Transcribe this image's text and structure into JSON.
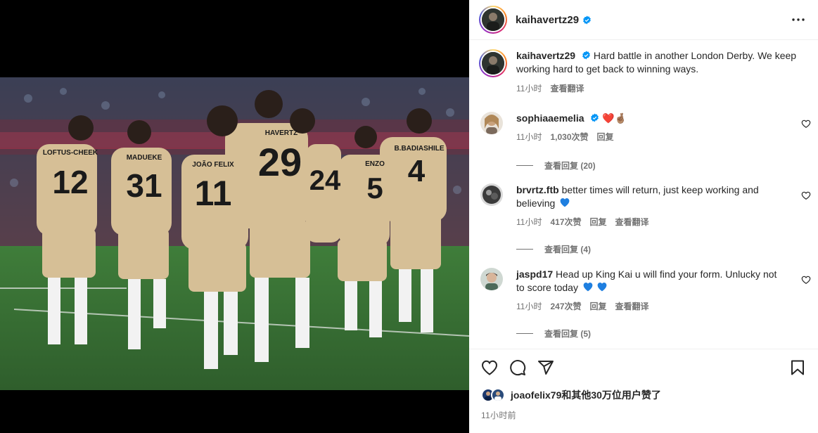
{
  "post": {
    "username": "kaihavertz29",
    "more_label": "•••"
  },
  "caption": {
    "username": "kaihavertz29",
    "text": "Hard battle in another London Derby. We keep working hard to get back to winning ways.",
    "time": "11小时",
    "translate": "查看翻译"
  },
  "comments": [
    {
      "username": "sophiaaemelia",
      "verified": true,
      "text": "❤️🤞🏽",
      "time": "11小时",
      "likes": "1,030次赞",
      "reply": "回复",
      "translate": "",
      "view_replies": "查看回复 (20)"
    },
    {
      "username": "brvrtz.ftb",
      "verified": false,
      "text": "better times will return, just keep working and believing",
      "time": "11小时",
      "likes": "417次赞",
      "reply": "回复",
      "translate": "查看翻译",
      "view_replies": "查看回复 (4)"
    },
    {
      "username": "jaspd17",
      "verified": false,
      "text": "Head up King Kai u will find your form. Unlucky not to score today",
      "time": "11小时",
      "likes": "247次赞",
      "reply": "回复",
      "translate": "查看翻译",
      "view_replies": "查看回复 (5)"
    }
  ],
  "likes": {
    "text": "joaofelix79和其他30万位用户赞了"
  },
  "posted": "11小时前",
  "photo": {
    "shirt_numbers": [
      "12",
      "31",
      "11",
      "29",
      "24",
      "5",
      "4"
    ],
    "shirt_names": [
      "LOFTUS-CHEEK",
      "MADUEKE",
      "JOÃO FELIX",
      "HAVERTZ",
      "ENZO",
      "B.BADIASHILE"
    ]
  },
  "colors": {
    "verified_blue": "#0095f6",
    "kit": "#d9c39b",
    "pitch": "#3d7a3a"
  }
}
